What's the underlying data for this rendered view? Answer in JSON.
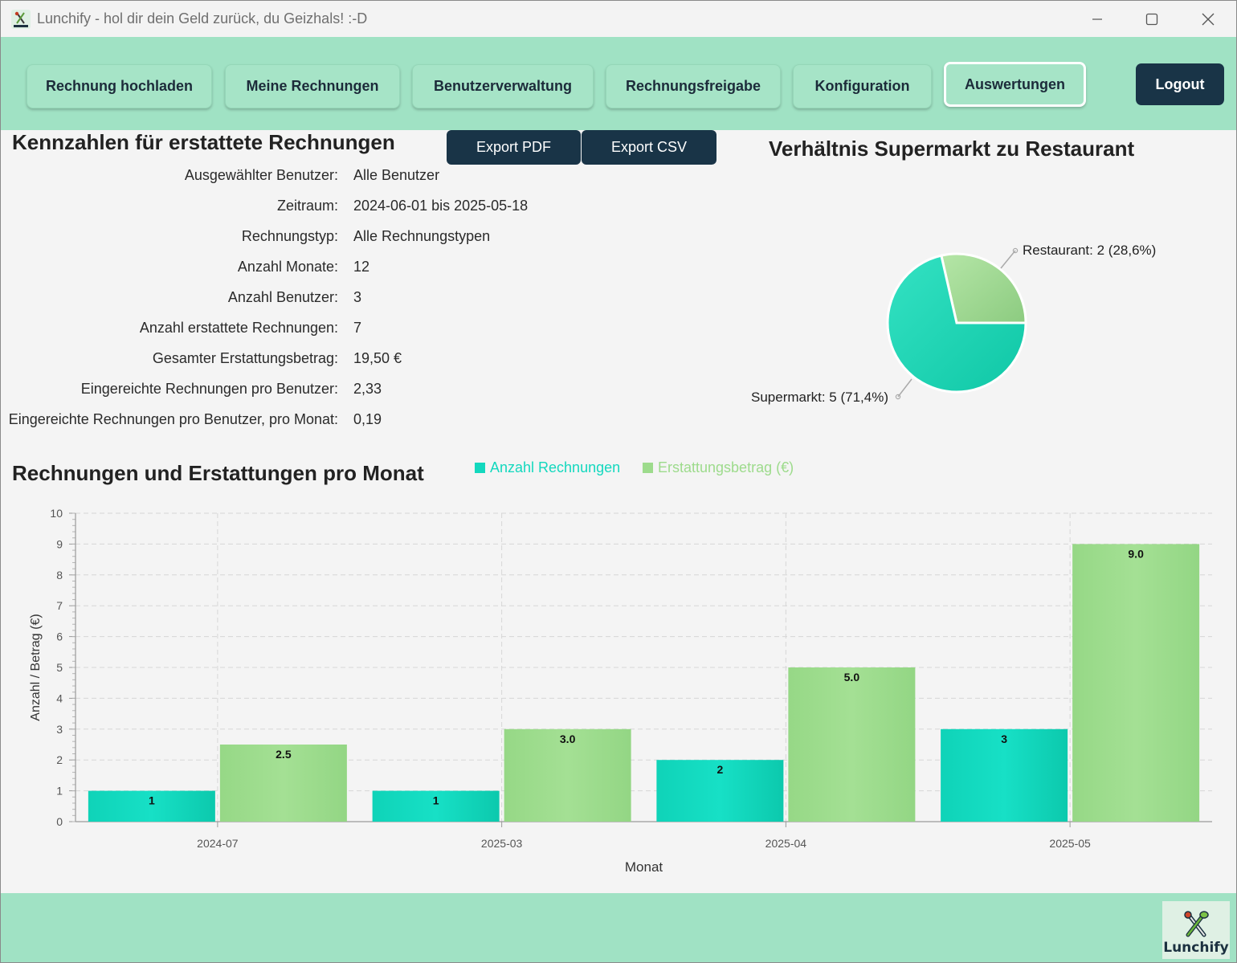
{
  "window": {
    "title": "Lunchify - hol dir dein Geld zurück, du Geizhals! :-D",
    "icon": "lunchify-app-icon",
    "controls": [
      "minimize-icon",
      "maximize-icon",
      "close-icon"
    ]
  },
  "nav": {
    "items": [
      {
        "label": "Rechnung hochladen"
      },
      {
        "label": "Meine Rechnungen"
      },
      {
        "label": "Benutzerverwaltung"
      },
      {
        "label": "Rechnungsfreigabe"
      },
      {
        "label": "Konfiguration"
      },
      {
        "label": "Auswertungen"
      }
    ],
    "active_index": 5,
    "logout_label": "Logout"
  },
  "kennzahlen": {
    "title": "Kennzahlen für erstattete Rechnungen",
    "export_pdf": "Export PDF",
    "export_csv": "Export CSV",
    "rows": [
      {
        "label": "Ausgewählter Benutzer:",
        "value": "Alle Benutzer"
      },
      {
        "label": "Zeitraum:",
        "value": "2024-06-01 bis 2025-05-18"
      },
      {
        "label": "Rechnungstyp:",
        "value": "Alle Rechnungstypen"
      },
      {
        "label": "Anzahl Monate:",
        "value": "12"
      },
      {
        "label": "Anzahl Benutzer:",
        "value": "3"
      },
      {
        "label": "Anzahl erstattete Rechnungen:",
        "value": "7"
      },
      {
        "label": "Gesamter Erstattungsbetrag:",
        "value": "19,50 €"
      },
      {
        "label": "Eingereichte Rechnungen pro Benutzer:",
        "value": "2,33"
      },
      {
        "label": "Eingereichte Rechnungen pro Benutzer, pro Monat:",
        "value": "0,19"
      }
    ]
  },
  "pie": {
    "title": "Verhältnis Supermarkt zu Restaurant",
    "label_restaurant": "Restaurant: 2 (28,6%)",
    "label_supermarkt": "Supermarkt: 5 (71,4%)"
  },
  "monthly": {
    "title": "Rechnungen und Erstattungen pro Monat"
  },
  "colors": {
    "accent": "#a0e2c4",
    "dark": "#193447",
    "series_count": "#13d8be",
    "series_amount": "#9ddb8c"
  },
  "footer": {
    "logo_text": "Lunchify"
  },
  "chart_data": [
    {
      "type": "pie",
      "title": "Verhältnis Supermarkt zu Restaurant",
      "slices": [
        {
          "label": "Supermarkt",
          "value": 5,
          "percent": 71.4,
          "display": "Supermarkt: 5 (71,4%)"
        },
        {
          "label": "Restaurant",
          "value": 2,
          "percent": 28.6,
          "display": "Restaurant: 2 (28,6%)"
        }
      ]
    },
    {
      "type": "bar",
      "title": "Rechnungen und Erstattungen pro Monat",
      "xlabel": "Monat",
      "ylabel": "Anzahl / Betrag (€)",
      "categories": [
        "2024-07",
        "2025-03",
        "2025-04",
        "2025-05"
      ],
      "ylim": [
        0,
        10
      ],
      "yticks": [
        0,
        1,
        2,
        3,
        4,
        5,
        6,
        7,
        8,
        9,
        10
      ],
      "grid": true,
      "legend_position": "top",
      "series": [
        {
          "name": "Anzahl Rechnungen",
          "values": [
            1,
            1,
            2,
            3
          ],
          "labels": [
            "1",
            "1",
            "2",
            "3"
          ]
        },
        {
          "name": "Erstattungsbetrag (€)",
          "values": [
            2.5,
            3.0,
            5.0,
            9.0
          ],
          "labels": [
            "2.5",
            "3.0",
            "5.0",
            "9.0"
          ]
        }
      ]
    }
  ]
}
